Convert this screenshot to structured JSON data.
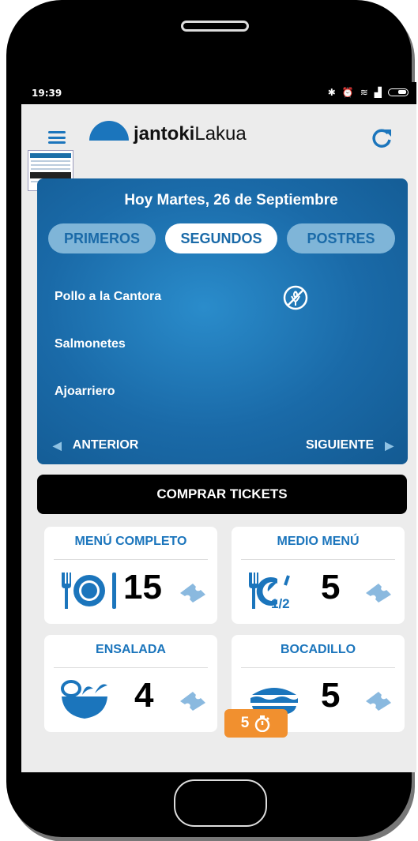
{
  "status_bar": {
    "time": "19:39"
  },
  "header": {
    "brand_bold": "jantoki",
    "brand_regular": "Lakua"
  },
  "menu": {
    "date": "Hoy Martes, 26 de Septiembre",
    "tabs": [
      {
        "label": "PRIMEROS",
        "active": false
      },
      {
        "label": "SEGUNDOS",
        "active": true
      },
      {
        "label": "POSTRES",
        "active": false
      }
    ],
    "dishes": [
      "Pollo a la Cantora",
      "Salmonetes",
      "Ajoarriero"
    ],
    "prev_label": "ANTERIOR",
    "next_label": "SIGUIENTE"
  },
  "buy": {
    "label": "COMPRAR TICKETS"
  },
  "tickets": [
    {
      "title": "MENÚ COMPLETO",
      "count": "15",
      "icon": "plate-cutlery-icon"
    },
    {
      "title": "MEDIO MENÚ",
      "count": "5",
      "icon": "half-plate-icon",
      "fraction": "1/2"
    },
    {
      "title": "ENSALADA",
      "count": "4",
      "icon": "salad-bowl-icon"
    },
    {
      "title": "BOCADILLO",
      "count": "5",
      "icon": "sandwich-icon"
    }
  ],
  "timer_badge": {
    "count": "5"
  },
  "colors": {
    "primary": "#1b75bc",
    "accent": "#f1902f",
    "card": "#1a6aa8"
  }
}
